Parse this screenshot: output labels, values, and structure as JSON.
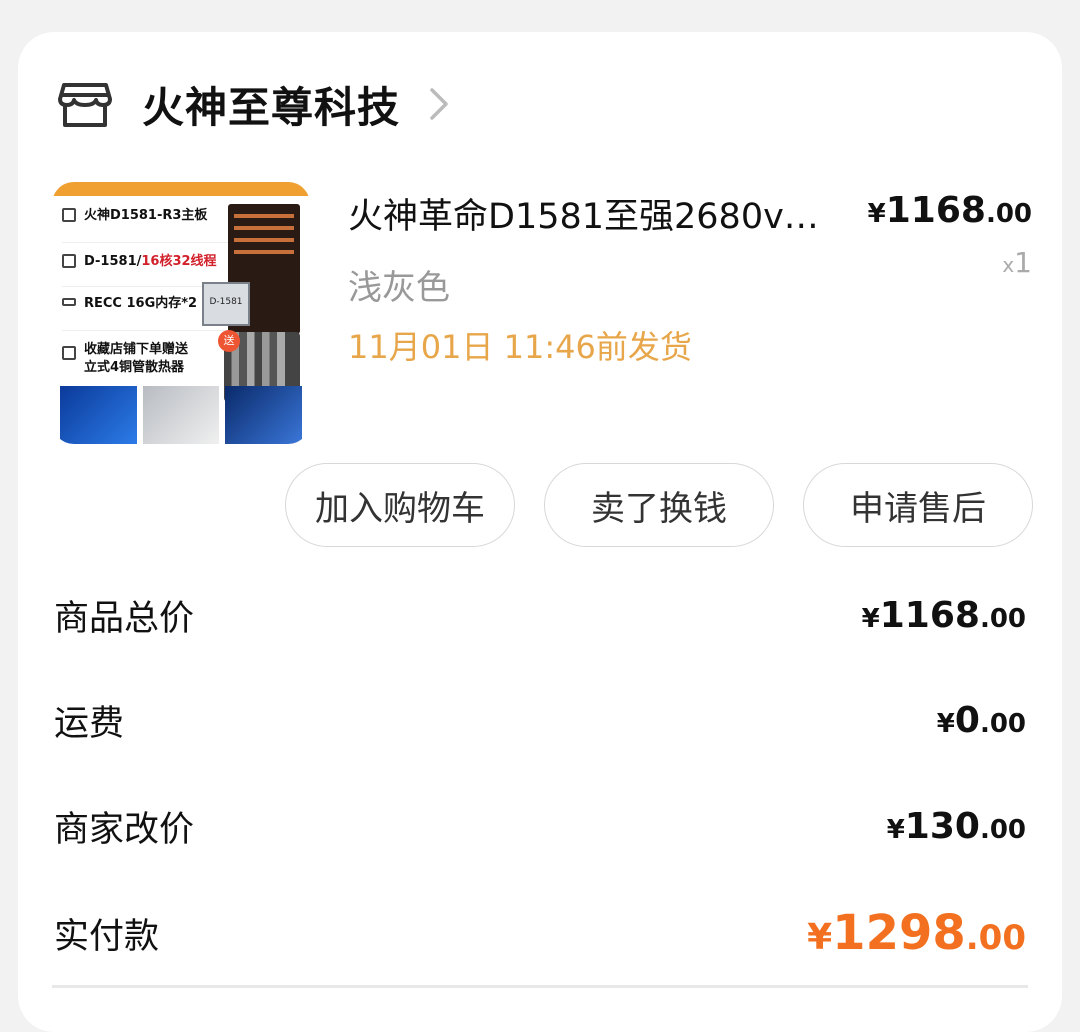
{
  "shop": {
    "name": "火神至尊科技",
    "icon": "store-icon",
    "chevron_icon": "chevron-right-icon"
  },
  "product": {
    "title": "火神革命D1581至强2680v…",
    "spec": "浅灰色",
    "ship_time": "11月01日 11:46前发货",
    "price": {
      "currency": "¥",
      "integer": "1168",
      "decimal": ".00"
    },
    "quantity": {
      "prefix": "x",
      "value": "1"
    },
    "thumbnail_text": {
      "row1": "火神D1581-R3主板",
      "row2_a": "D-1581/",
      "row2_b": "16核32线程",
      "row3": "RECC 16G内存*2",
      "row4_a": "收藏店铺下单赠送",
      "row4_b": "立式4铜管散热器",
      "chip_label": "D-1581",
      "gift_label": "送"
    }
  },
  "actions": {
    "add_to_cart": "加入购物车",
    "sell_for_cash": "卖了换钱",
    "after_sales": "申请售后"
  },
  "summary": {
    "goods_total": {
      "label": "商品总价",
      "currency": "¥",
      "integer": "1168",
      "decimal": ".00"
    },
    "shipping": {
      "label": "运费",
      "currency": "¥",
      "integer": "0",
      "decimal": ".00"
    },
    "merchant_adjust": {
      "label": "商家改价",
      "currency": "¥",
      "integer": "130",
      "decimal": ".00"
    },
    "paid": {
      "label": "实付款",
      "currency": "¥",
      "integer": "1298",
      "decimal": ".00"
    }
  },
  "colors": {
    "accent_orange": "#f2701f",
    "ship_time": "#e8a64a",
    "muted": "#999999"
  }
}
